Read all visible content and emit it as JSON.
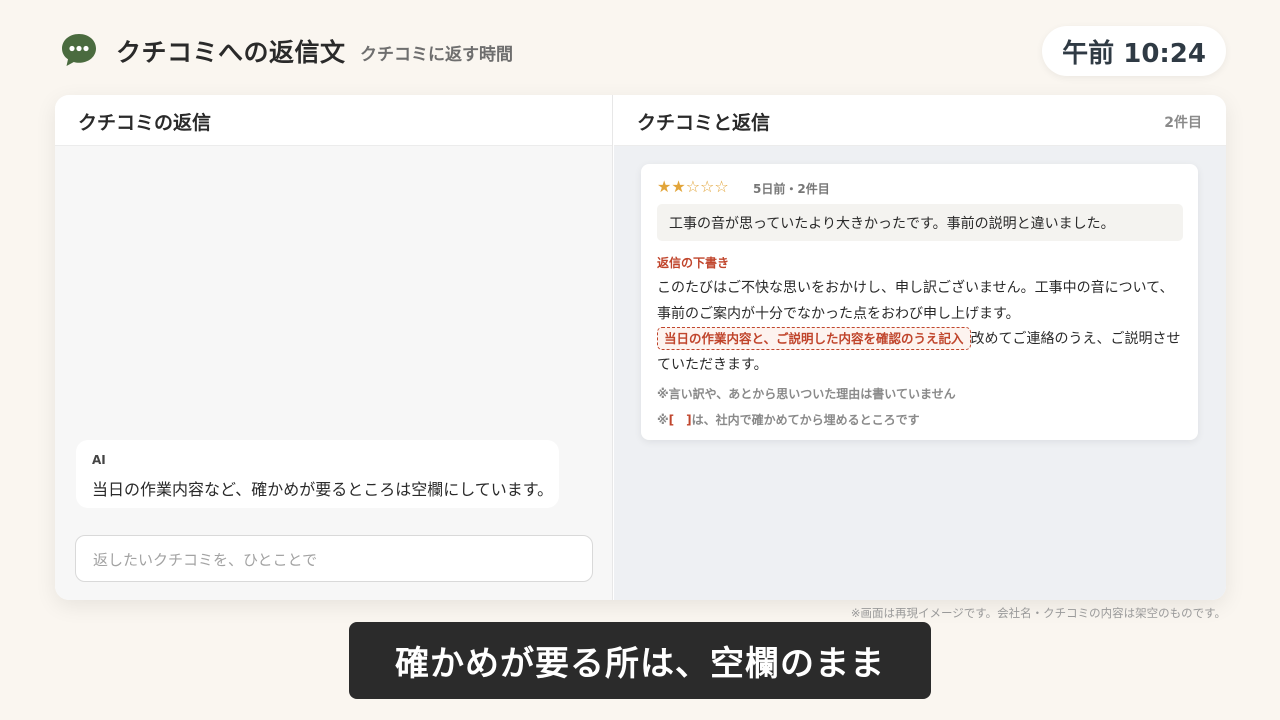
{
  "header": {
    "app_icon": "chat-bubble-icon",
    "title": "クチコミへの返信文",
    "subtitle": "クチコミに返す時間",
    "clock": "午前 10:24"
  },
  "left_panel": {
    "title": "クチコミの返信",
    "ai_message": {
      "sender": "AI",
      "text": "当日の作業内容など、確かめが要るところは空欄にしています。"
    },
    "input": {
      "placeholder": "返したいクチコミを、ひとことで"
    }
  },
  "right_panel": {
    "title": "クチコミと返信",
    "count": "2件目",
    "review": {
      "stars": "★★☆☆☆",
      "rating": 2,
      "max_rating": 5,
      "meta": "5日前・2件目",
      "body": "工事の音が思っていたより大きかったです。事前の説明と違いました。",
      "draft_label": "返信の下書き",
      "draft_part1": "このたびはご不快な思いをおかけし、申し訳ございません。工事中の音について、事前のご案内が十分でなかった点をおわび申し上げます。",
      "draft_placeholder": "当日の作業内容と、ご説明した内容を確認のうえ記入",
      "draft_part2": "改めてご連絡のうえ、ご説明させていただきます。",
      "note1": "※言い訳や、あとから思いついた理由は書いていません",
      "note2_prefix": "※",
      "note2_bracket": "[　]",
      "note2_suffix": "は、社内で確かめてから埋めるところです"
    }
  },
  "footer": {
    "disclaimer": "※画面は再現イメージです。会社名・クチコミの内容は架空のものです。",
    "caption": "確かめが要る所は、空欄のまま"
  },
  "colors": {
    "accent": "#c0452c",
    "star": "#e2a53a",
    "icon_green": "#4a6b3f"
  }
}
